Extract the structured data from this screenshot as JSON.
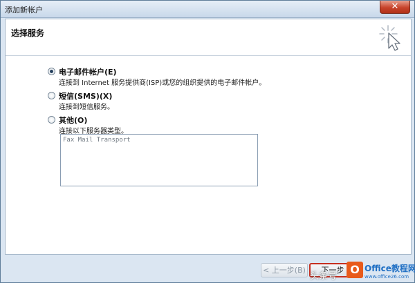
{
  "window": {
    "title": "添加新帐户",
    "close_glyph": "✕"
  },
  "header": {
    "heading": "选择服务",
    "icon": "wizard-cursor-icon"
  },
  "options": [
    {
      "label": "电子邮件帐户(E)",
      "description": "连接到 Internet 服务提供商(ISP)或您的组织提供的电子邮件帐户。",
      "selected": true
    },
    {
      "label": "短信(SMS)(X)",
      "description": "连接到短信服务。",
      "selected": false
    },
    {
      "label": "其他(O)",
      "description": "连接以下服务器类型。",
      "selected": false
    }
  ],
  "server_list": {
    "items": [
      "Fax Mail Transport"
    ]
  },
  "buttons": {
    "prev": "< 上一步(B)",
    "next": "下一步"
  },
  "watermark": {
    "text": "头条号",
    "logo_letter": "O",
    "site_title": "Office教程网",
    "site_url": "www.office26.com"
  }
}
